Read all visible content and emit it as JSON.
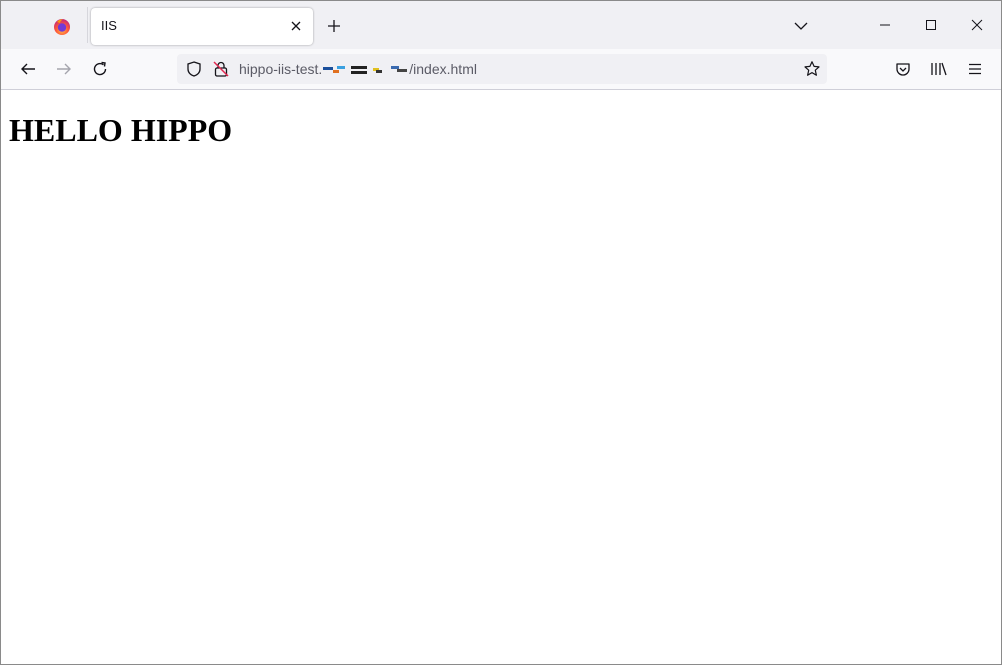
{
  "browser": {
    "tab": {
      "title": "IIS"
    },
    "url": {
      "prefix": "hippo-iis-test.",
      "suffix": "/index.html"
    },
    "icons": {
      "app": "firefox-icon",
      "back": "arrow-left-icon",
      "forward": "arrow-right-icon",
      "reload": "reload-icon",
      "shield": "shield-icon",
      "lock": "insecure-lock-icon",
      "bookmark": "star-icon",
      "pocket": "pocket-icon",
      "library": "library-icon",
      "menu": "hamburger-menu-icon"
    }
  },
  "page": {
    "heading": "HELLO HIPPO"
  },
  "colors": {
    "tabstrip": "#f0f0f4",
    "toolbar": "#f9f9fb",
    "urlbar": "#f0f0f4",
    "url_text": "#5b5b66",
    "insecure_accent": "#e22850"
  }
}
